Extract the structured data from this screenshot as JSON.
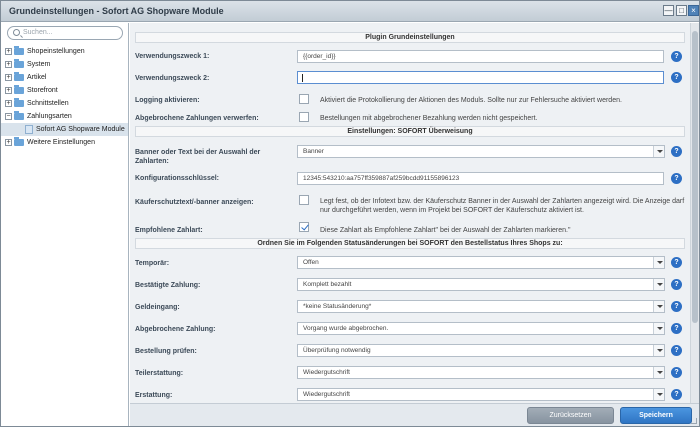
{
  "window": {
    "title": "Grundeinstellungen - Sofort AG Shopware Module",
    "btn_min": "—",
    "btn_max": "□",
    "btn_close": "×"
  },
  "sidebar": {
    "search_placeholder": "Suchen...",
    "items": [
      {
        "label": "Shopeinstellungen",
        "expander": "+"
      },
      {
        "label": "System",
        "expander": "+"
      },
      {
        "label": "Artikel",
        "expander": "+"
      },
      {
        "label": "Storefront",
        "expander": "+"
      },
      {
        "label": "Schnittstellen",
        "expander": "+"
      },
      {
        "label": "Zahlungsarten",
        "expander": "−"
      },
      {
        "label": "Sofort AG Shopware Module",
        "expander": ""
      },
      {
        "label": "Weitere Einstellungen",
        "expander": "+"
      }
    ]
  },
  "sections": {
    "plugin": "Plugin Grundeinstellungen",
    "sofort": "Einstellungen: SOFORT Überweisung",
    "status": "Ordnen Sie im Folgenden Statusänderungen bei SOFORT den Bestellstatus Ihres Shops zu:"
  },
  "help_glyph": "?",
  "fields": {
    "verwendungszweck1": {
      "label": "Verwendungszweck 1:",
      "value": "{{order_id}}"
    },
    "verwendungszweck2": {
      "label": "Verwendungszweck 2:",
      "value": ""
    },
    "logging": {
      "label": "Logging aktivieren:",
      "text": "Aktiviert die Protokollierung der Aktionen des Moduls. Sollte nur zur Fehlersuche aktiviert werden.",
      "checked": false
    },
    "abgebrochen_verwerfen": {
      "label": "Abgebrochene Zahlungen verwerfen:",
      "text": "Bestellungen mit abgebrochener Bezahlung werden nicht gespeichert.",
      "checked": false
    },
    "banner": {
      "label": "Banner oder Text bei der Auswahl der Zahlarten:",
      "value": "Banner"
    },
    "konfig": {
      "label": "Konfigurationsschlüssel:",
      "value": "12345:543210:aa757ff359887af259bcdd91155896123"
    },
    "kaeuferschutz": {
      "label": "Käuferschutztext/-banner anzeigen:",
      "text": "Legt fest, ob der Infotext bzw. der Käuferschutz Banner in der Auswahl der Zahlarten angezeigt wird. Die Anzeige darf nur durchgeführt werden, wenn im Projekt bei SOFORT der Käuferschutz aktiviert ist.",
      "checked": false
    },
    "empfohlen": {
      "label": "Empfohlene Zahlart:",
      "text": "Diese Zahlart als Empfohlene Zahlart\" bei der Auswahl der Zahlarten markieren.\"",
      "checked": true
    },
    "temporaer": {
      "label": "Temporär:",
      "value": "Offen"
    },
    "bestaetigt": {
      "label": "Bestätigte Zahlung:",
      "value": "Komplett bezahlt"
    },
    "geldeingang": {
      "label": "Geldeingang:",
      "value": "*keine Statusänderung*"
    },
    "abgebrochen": {
      "label": "Abgebrochene Zahlung:",
      "value": "Vorgang wurde abgebrochen."
    },
    "pruefen": {
      "label": "Bestellung prüfen:",
      "value": "Überprüfung notwendig"
    },
    "teilerstattung": {
      "label": "Teilerstattung:",
      "value": "Wiedergutschrift"
    },
    "erstattung": {
      "label": "Erstattung:",
      "value": "Wiedergutschrift"
    }
  },
  "footer": {
    "reset_label": "Zurücksetzen",
    "save_label": "Speichern"
  }
}
